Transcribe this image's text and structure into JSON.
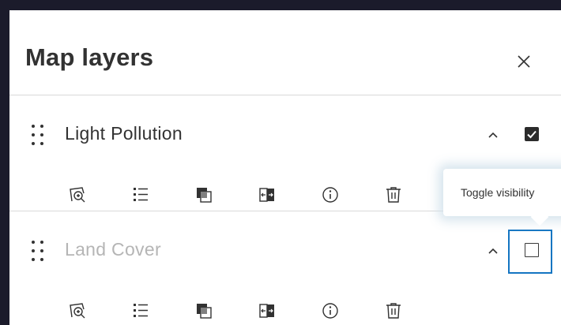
{
  "panel": {
    "title": "Map layers",
    "close_icon": "close-icon"
  },
  "layers": [
    {
      "name": "Light Pollution",
      "visible": true,
      "dimmed": false,
      "actions": [
        "zoom-to-icon",
        "legend-icon",
        "transparency-icon",
        "swipe-icon",
        "info-icon",
        "delete-icon"
      ]
    },
    {
      "name": "Land Cover",
      "visible": false,
      "dimmed": true,
      "actions": [
        "zoom-to-icon",
        "legend-icon",
        "transparency-icon",
        "swipe-icon",
        "info-icon",
        "delete-icon"
      ]
    }
  ],
  "tooltip": {
    "text": "Toggle visibility"
  },
  "colors": {
    "background": "#1b1b2b",
    "text": "#323232",
    "dimmed_text": "#b5b5b5",
    "focus": "#1475c2"
  }
}
